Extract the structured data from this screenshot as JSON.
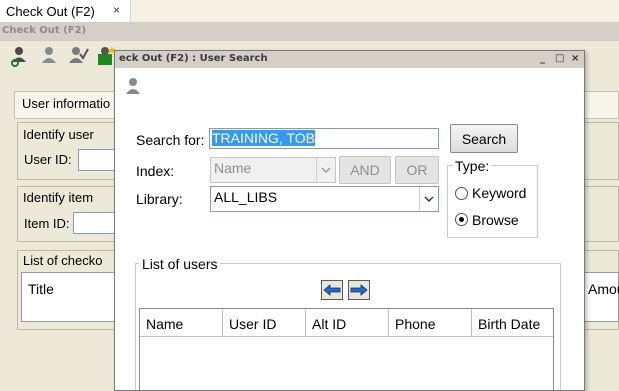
{
  "tab": {
    "label": "Check Out (F2)",
    "close": "×"
  },
  "window": {
    "title": "Check Out (F2)"
  },
  "toolbar": {
    "icons": [
      "user-icon",
      "user-gray-icon",
      "user-check-icon",
      "user-new-icon"
    ]
  },
  "background": {
    "tab_label": "User informatio",
    "identify_user": "Identify user",
    "user_id_label": "User ID:",
    "identify_item": "Identify item",
    "item_id_label": "Item ID:",
    "checkouts_label": "List of checko",
    "title_col": "Title",
    "amount_col": "Amou"
  },
  "modal": {
    "title": "eck Out (F2) : User Search",
    "controls": {
      "minimize": "_",
      "maximize": "□",
      "close": "×"
    },
    "search_label": "Search for:",
    "search_value": "TRAINING, TOB",
    "search_button": "Search",
    "index_label": "Index:",
    "index_value": "Name",
    "and_button": "AND",
    "or_button": "OR",
    "type_label": "Type:",
    "keyword_label": "Keyword",
    "browse_label": "Browse",
    "selected_type": "Browse",
    "library_label": "Library:",
    "library_value": "ALL_LIBS",
    "list_label": "List of users",
    "columns": [
      "Name",
      "User ID",
      "Alt ID",
      "Phone",
      "Birth Date"
    ]
  }
}
